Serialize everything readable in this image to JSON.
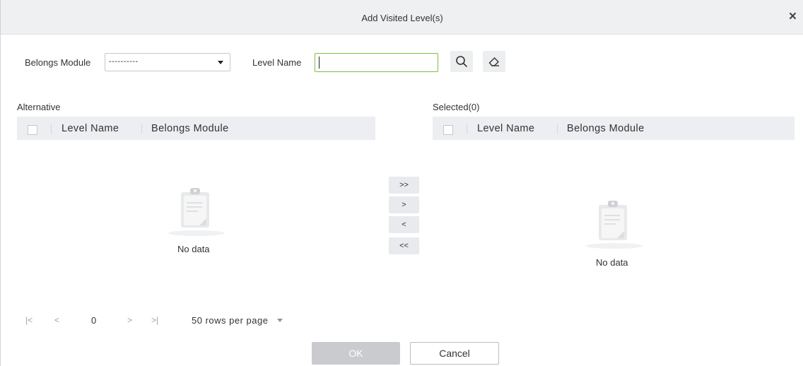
{
  "dialog": {
    "title": "Add Visited Level(s)",
    "close_icon": "close-icon"
  },
  "filters": {
    "belongs_module_label": "Belongs Module",
    "belongs_module_value": "----------",
    "level_name_label": "Level Name",
    "level_name_value": "",
    "search_icon": "search-icon",
    "clear_icon": "eraser-icon"
  },
  "alternative": {
    "label": "Alternative",
    "columns": [
      "Level Name",
      "Belongs Module"
    ],
    "empty_text": "No data"
  },
  "selected": {
    "label": "Selected(0)",
    "columns": [
      "Level Name",
      "Belongs Module"
    ],
    "empty_text": "No data"
  },
  "transfer": {
    "add_all": ">>",
    "add": ">",
    "remove": "<",
    "remove_all": "<<"
  },
  "pager": {
    "first": "|<",
    "prev": "<",
    "page": "0",
    "next": ">",
    "last": ">|",
    "rows_per_page": "50 rows per page"
  },
  "footer": {
    "ok_label": "OK",
    "cancel_label": "Cancel"
  },
  "colors": {
    "input_focus_border": "#7ac143",
    "header_bg": "#eef0f2",
    "ok_disabled_bg": "#c9cbcf"
  }
}
